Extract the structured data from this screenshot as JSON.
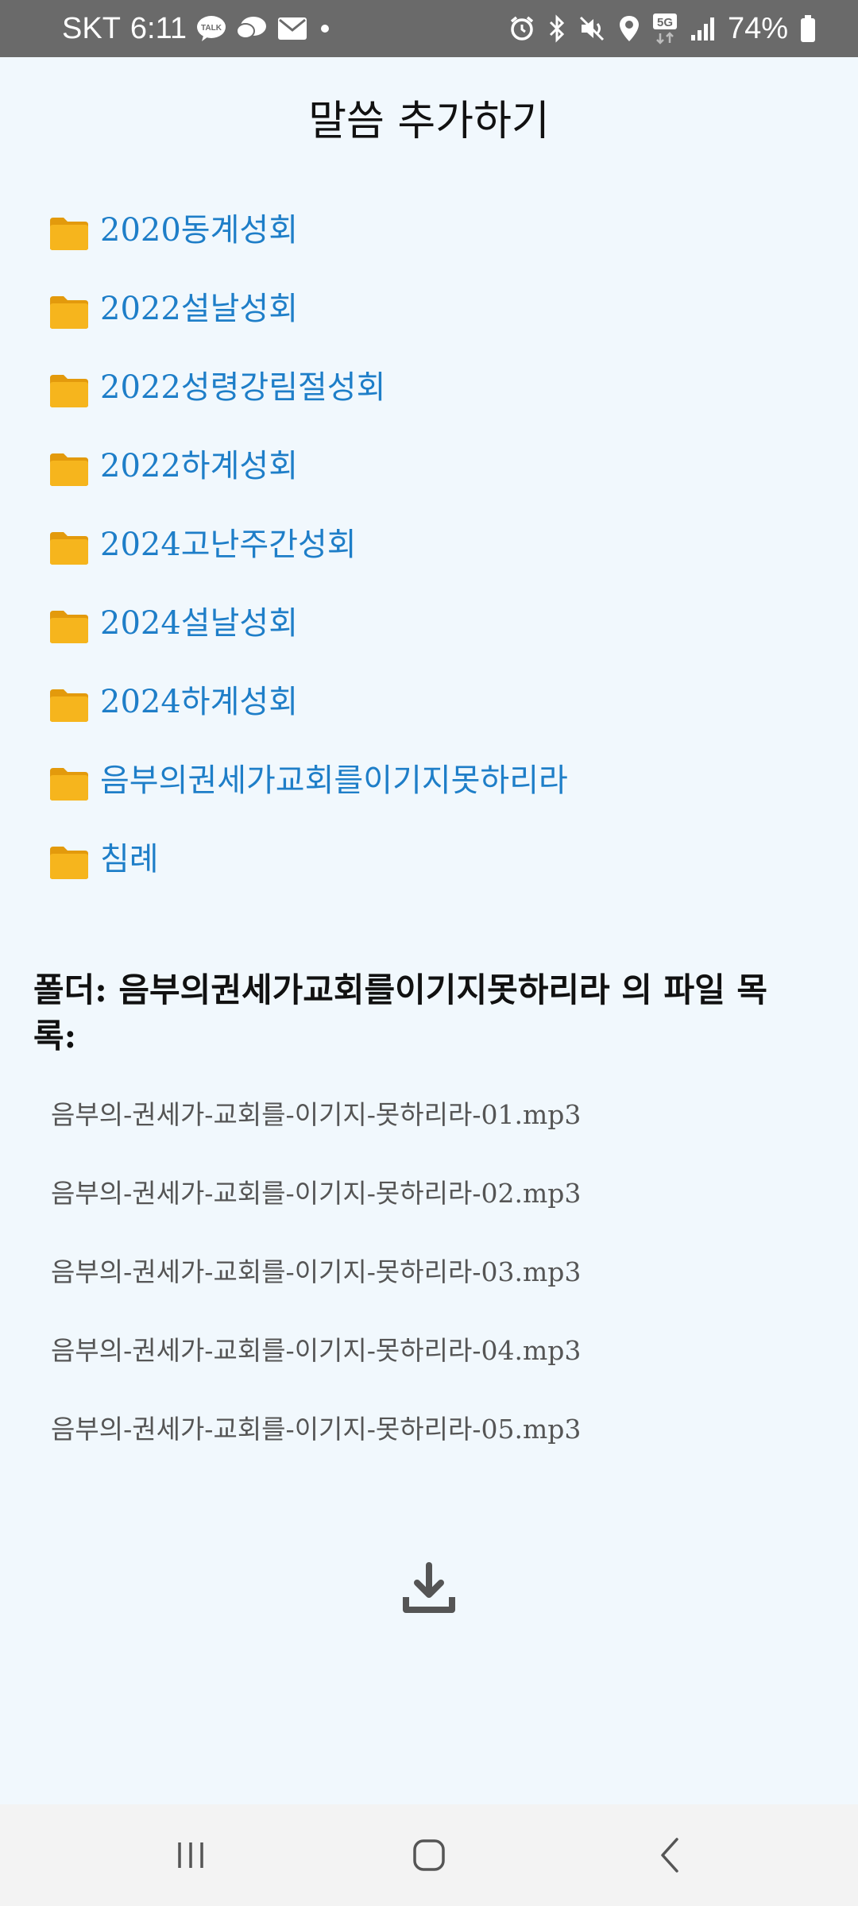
{
  "status_bar": {
    "carrier": "SKT",
    "time": "6:11",
    "network": "5G",
    "battery": "74%",
    "left_icons": [
      "kakaotalk-icon",
      "chat-bubble-icon",
      "mail-icon",
      "dot-icon"
    ],
    "right_icons": [
      "alarm-icon",
      "bluetooth-icon",
      "mute-icon",
      "location-icon",
      "network-5g-icon",
      "signal-icon",
      "battery-icon"
    ]
  },
  "app": {
    "title": "말씀 추가하기"
  },
  "folders": [
    {
      "label": "2020동계성회"
    },
    {
      "label": "2022설날성회"
    },
    {
      "label": "2022성령강림절성회"
    },
    {
      "label": "2022하계성회"
    },
    {
      "label": "2024고난주간성회"
    },
    {
      "label": "2024설날성회"
    },
    {
      "label": "2024하계성회"
    },
    {
      "label": "음부의권세가교회를이기지못하리라"
    },
    {
      "label": "침례"
    }
  ],
  "files_section": {
    "heading": "폴더: 음부의권세가교회를이기지못하리라 의 파일 목록:",
    "files": [
      {
        "name": "음부의-권세가-교회를-이기지-못하리라-01.mp3"
      },
      {
        "name": "음부의-권세가-교회를-이기지-못하리라-02.mp3"
      },
      {
        "name": "음부의-권세가-교회를-이기지-못하리라-03.mp3"
      },
      {
        "name": "음부의-권세가-교회를-이기지-못하리라-04.mp3"
      },
      {
        "name": "음부의-권세가-교회를-이기지-못하리라-05.mp3"
      }
    ]
  },
  "actions": {
    "download_icon": "download-icon"
  },
  "nav_bar": {
    "icons": [
      "recent-apps-icon",
      "home-icon",
      "back-icon"
    ]
  },
  "colors": {
    "background": "#f1f8fd",
    "folder_link": "#1e7ec8",
    "folder_icon": "#f6b51d",
    "status_bar": "#6a6a6a",
    "file_text": "#555555"
  }
}
